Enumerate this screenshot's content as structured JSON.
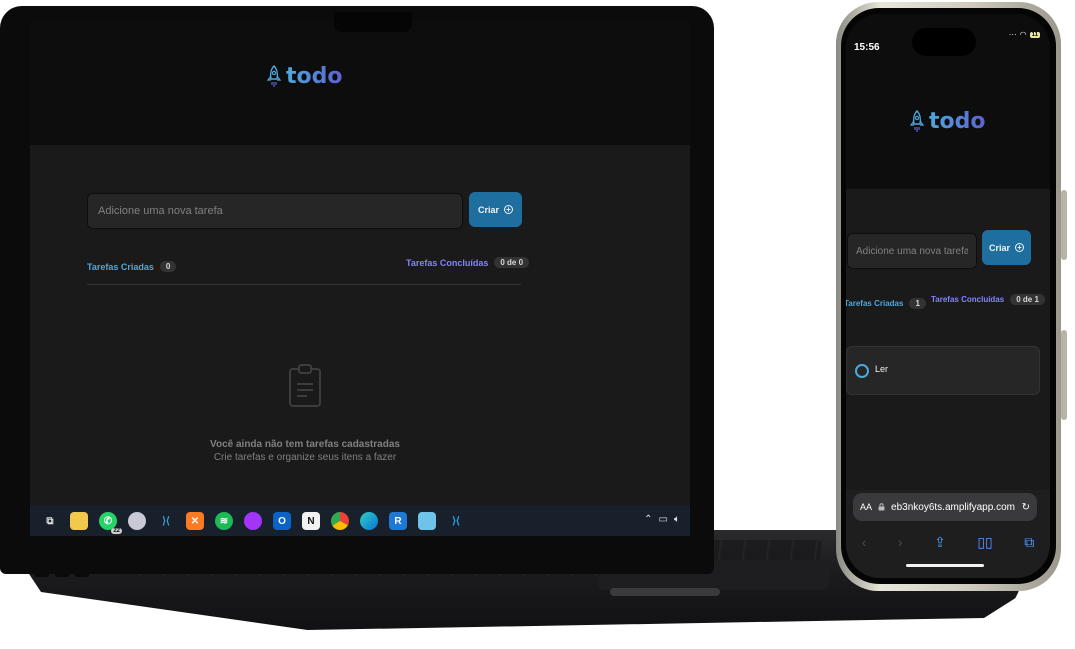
{
  "app": {
    "logo_text": "todo",
    "accent_blue": "#4ea8de",
    "accent_purple": "#8284fa",
    "button_color": "#1e6f9f"
  },
  "laptop": {
    "input_placeholder": "Adicione uma nova tarefa",
    "create_label": "Criar",
    "created_label": "Tarefas Criadas",
    "created_count": "0",
    "done_label": "Tarefas Concluídas",
    "done_count": "0 de 0",
    "empty_title": "Você ainda não tem tarefas cadastradas",
    "empty_subtitle": "Crie tarefas e organize seus itens a fazer",
    "taskbar": {
      "icons": [
        "task-view-icon",
        "file-explorer-icon",
        "whatsapp-icon",
        "app-icon",
        "vscode-insiders-icon",
        "xampp-icon",
        "spotify-icon",
        "messenger-icon",
        "outlook-icon",
        "notion-icon",
        "chrome-icon",
        "edge-icon",
        "rdm-icon",
        "notepad-icon",
        "vscode-icon"
      ],
      "whatsapp_badge": "22"
    }
  },
  "phone": {
    "time": "15:56",
    "battery": "11",
    "input_placeholder": "Adicione uma nova tarefa",
    "create_label": "Criar",
    "created_label": "Tarefas Criadas",
    "created_count": "1",
    "done_label": "Tarefas Concluídas",
    "done_count": "0 de 1",
    "tasks": [
      {
        "text": "Ler",
        "done": false
      }
    ],
    "safari": {
      "aa": "AA",
      "url": "eb3nkoy6ts.amplifyapp.com"
    }
  }
}
